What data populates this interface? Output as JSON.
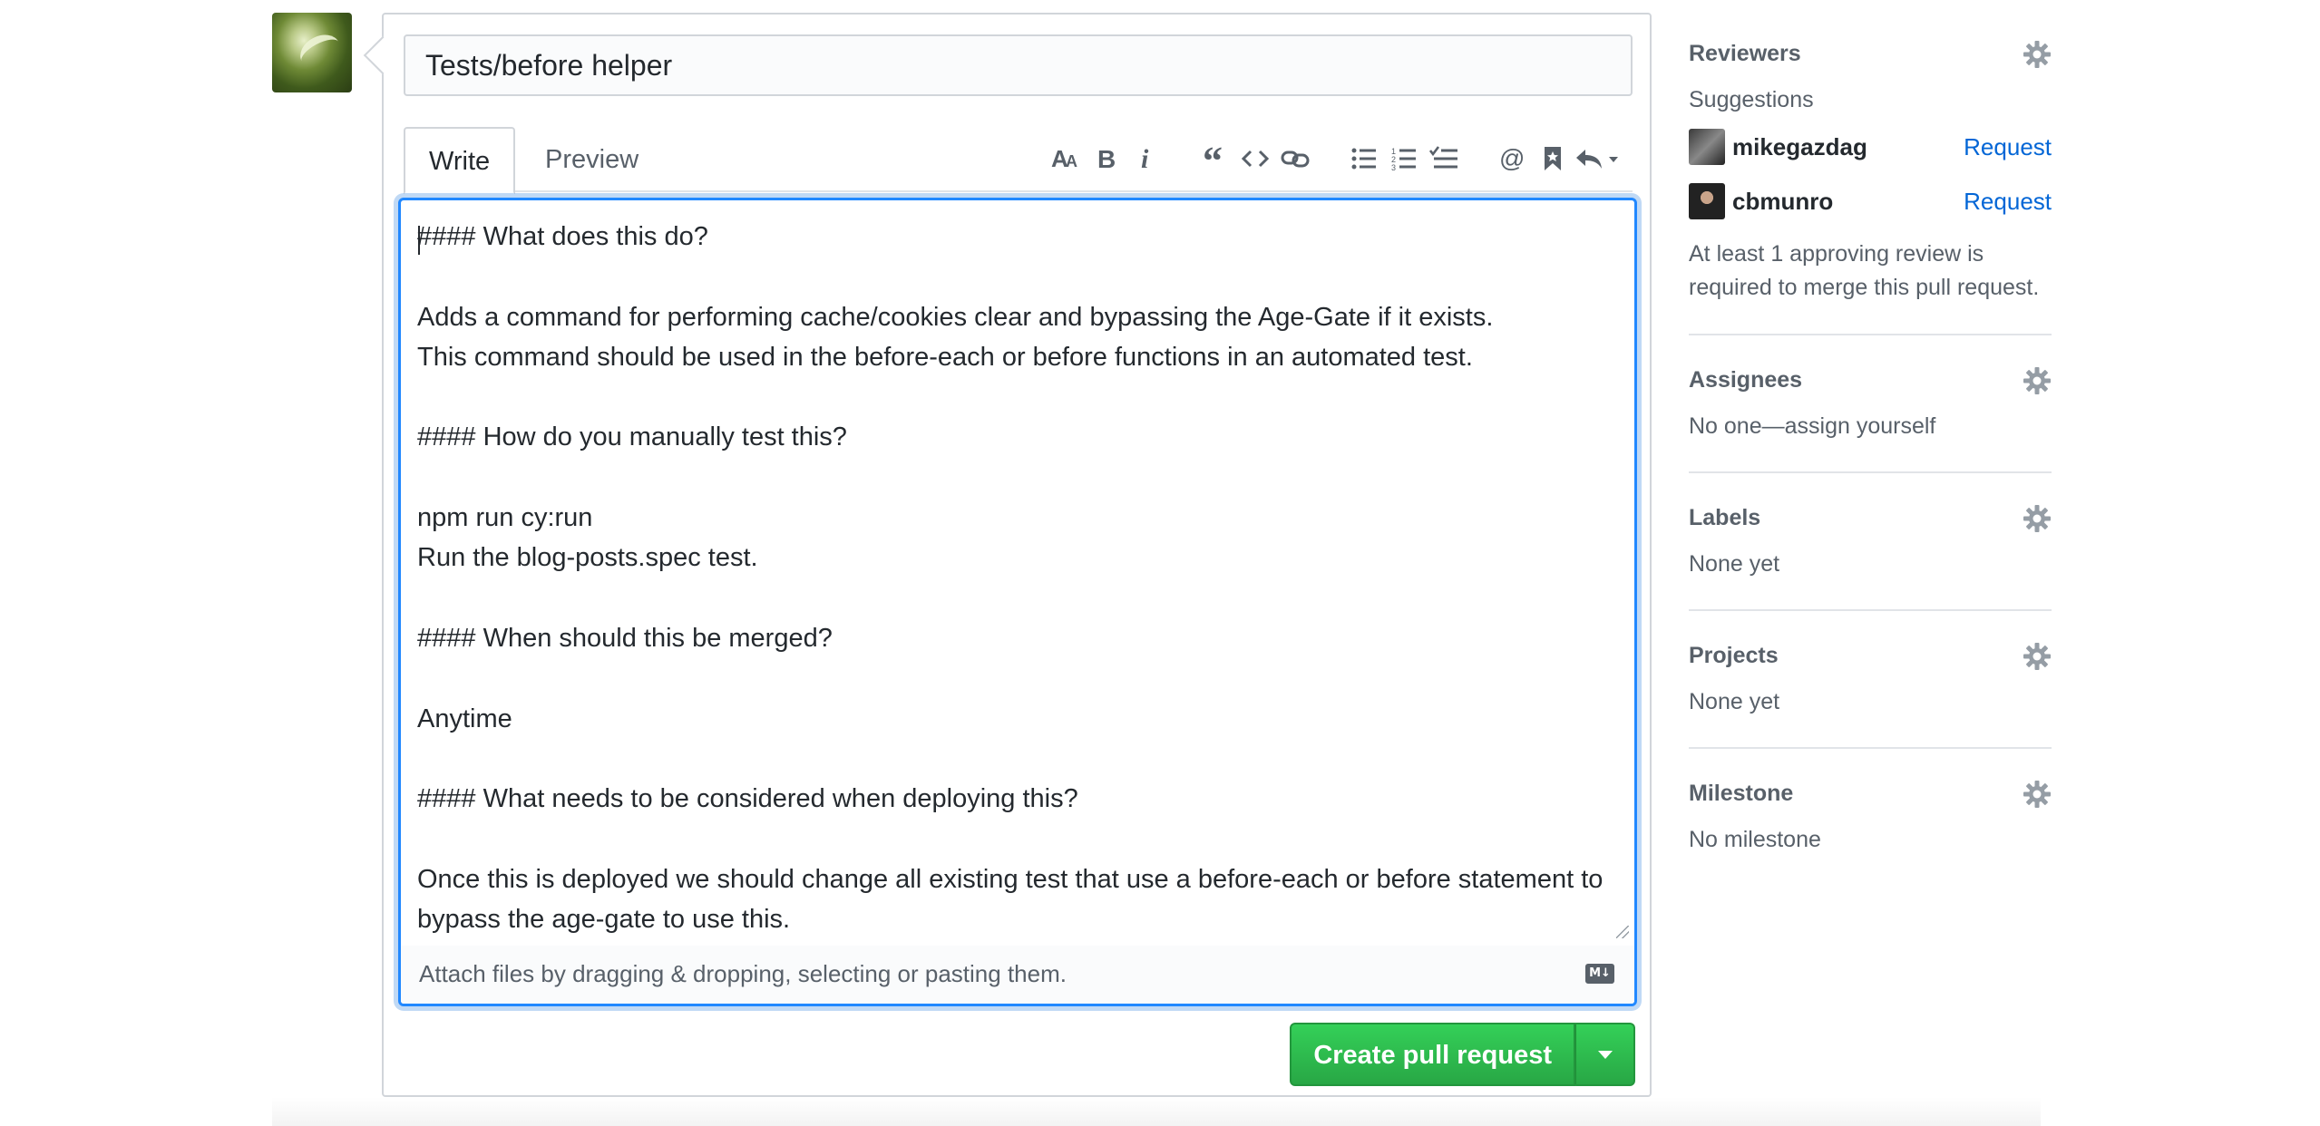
{
  "pull_request": {
    "title": "Tests/before helper",
    "body_lines": [
      "#### What does this do?",
      "",
      "Adds a command for performing cache/cookies clear and bypassing the Age-Gate if it exists.",
      "This command should be used in the before-each or before functions in an automated test.",
      "",
      "#### How do you manually test this?",
      "",
      "npm run cy:run",
      "Run the blog-posts.spec test.",
      "",
      "#### When should this be merged?",
      "",
      "Anytime",
      "",
      "#### What needs to be considered when deploying this?",
      "",
      "Once this is deployed we should change all existing test that use a before-each or before statement to",
      "bypass the age-gate to use this."
    ]
  },
  "tabs": {
    "write": "Write",
    "preview": "Preview"
  },
  "toolbar": {
    "groups": [
      [
        "text-size-icon",
        "bold-icon",
        "italic-icon"
      ],
      [
        "quote-icon",
        "code-icon",
        "link-icon"
      ],
      [
        "bulleted-list-icon",
        "numbered-list-icon",
        "task-list-icon"
      ],
      [
        "mention-icon",
        "saved-reply-icon",
        "reply-dropdown-icon"
      ]
    ]
  },
  "attach": {
    "text": "Attach files by dragging & dropping, selecting or pasting them.",
    "markdown_badge": "M↓"
  },
  "submit": {
    "label": "Create pull request"
  },
  "sidebar": {
    "reviewers": {
      "heading": "Reviewers",
      "suggestions_label": "Suggestions",
      "people": [
        {
          "name": "mikegazdag",
          "action": "Request"
        },
        {
          "name": "cbmunro",
          "action": "Request"
        }
      ],
      "note": "At least 1 approving review is required to merge this pull request."
    },
    "assignees": {
      "heading": "Assignees",
      "text": "No one—assign yourself"
    },
    "labels": {
      "heading": "Labels",
      "text": "None yet"
    },
    "projects": {
      "heading": "Projects",
      "text": "None yet"
    },
    "milestone": {
      "heading": "Milestone",
      "text": "No milestone"
    }
  },
  "colors": {
    "accent": "#0366d6",
    "create_button": "#28a745",
    "focus": "#2188ff"
  }
}
